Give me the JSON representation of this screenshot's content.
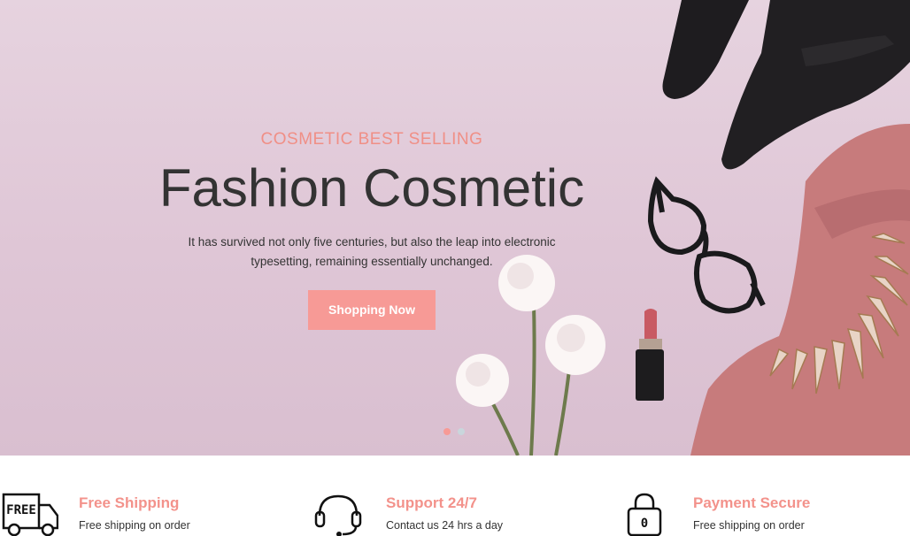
{
  "hero": {
    "subtitle": "COSMETIC BEST SELLING",
    "title": "Fashion Cosmetic",
    "description_line1": "It has survived not only five centuries, but also the leap into electronic",
    "description_line2": "typesetting, remaining essentially unchanged.",
    "button_label": "Shopping Now",
    "slides_count": 2,
    "active_slide": 1,
    "accent_color": "#f79a96"
  },
  "features": [
    {
      "icon": "free-truck-icon",
      "icon_text": "FREE",
      "title": "Free Shipping",
      "desc": "Free shipping on order"
    },
    {
      "icon": "headset-icon",
      "title": "Support 24/7",
      "desc": "Contact us 24 hrs a day"
    },
    {
      "icon": "padlock-icon",
      "icon_text": "0",
      "title": "Payment Secure",
      "desc": "Free shipping on order"
    }
  ]
}
